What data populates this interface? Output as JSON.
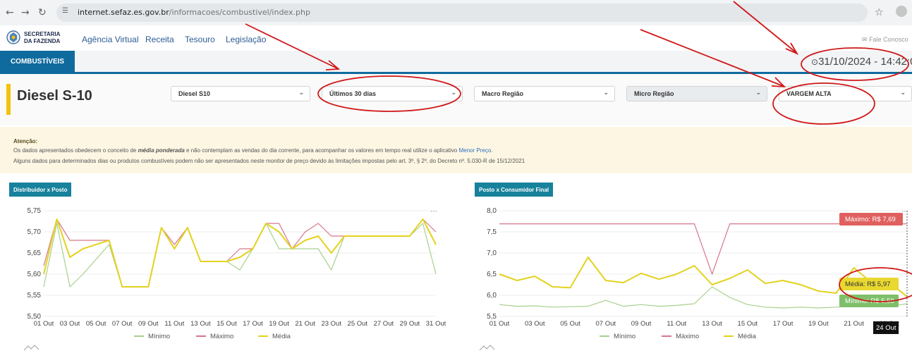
{
  "browser": {
    "back_icon": "back-arrow-icon",
    "url_host": "internet.sefaz.es.gov.br",
    "url_path": "/informacoes/combustivel/index.php"
  },
  "header": {
    "logo_line1": "SECRETARIA",
    "logo_line2": "DA FAZENDA",
    "menu": [
      "Agência Virtual",
      "Receita",
      "Tesouro",
      "Legislação"
    ],
    "contact": "Fale Conosco"
  },
  "tabs": {
    "active": "COMBUSTÍVEIS"
  },
  "clock": "31/10/2024 - 14:42:0",
  "filters": {
    "product_title": "Diesel S-10",
    "product": "Diesel S10",
    "period": "Últimos 30 dias",
    "macro_region": "Macro Região",
    "micro_region": "Micro Região",
    "city": "VARGEM ALTA"
  },
  "alert": {
    "title": "Atenção:",
    "line1_before": "Os dados apresentados obedecem o conceito de ",
    "line1_em": "média ponderada",
    "line1_after": " e não contemplam as vendas do dia corrente, para acompanhar os valores em tempo real utilize o aplicativo ",
    "line1_link": "Menor Preço",
    "line1_end": ".",
    "line2": "Alguns dados para determinados dias ou produtos combustíveis podem não ser apresentados neste monitor de preço devido às limitações impostas pelo art. 3º, § 2º, do Decreto nº. 5.030-R de 15/12/2021"
  },
  "colors": {
    "minimo": "#a8d08d",
    "maximo": "#d6768a",
    "media": "#e3d21f",
    "accent": "#0f6b9e"
  },
  "chart_data": [
    {
      "type": "line",
      "title": "Distribuidor x Posto",
      "tick_labels": [
        "01 Out",
        "03 Out",
        "05 Out",
        "07 Out",
        "09 Out",
        "11 Out",
        "13 Out",
        "15 Out",
        "17 Out",
        "19 Out",
        "21 Out",
        "23 Out",
        "25 Out",
        "27 Out",
        "29 Out",
        "31 Out"
      ],
      "y_ticks": [
        "5,75",
        "5,70",
        "5,65",
        "5,60",
        "5,55",
        "5,50"
      ],
      "ylim": [
        5.5,
        5.75
      ],
      "xlim": [
        1,
        31
      ],
      "legend": [
        "Mínimo",
        "Máximo",
        "Média"
      ],
      "series": [
        {
          "name": "Mínimo",
          "x": [
            1,
            2,
            3,
            4,
            6,
            7,
            8,
            9,
            10,
            11,
            12,
            13,
            14,
            15,
            16,
            17,
            18,
            19,
            20,
            21,
            22,
            23,
            24,
            25,
            26,
            27,
            28,
            29,
            30,
            31
          ],
          "y": [
            5.57,
            5.72,
            5.57,
            5.6,
            5.67,
            5.57,
            5.57,
            5.57,
            5.71,
            5.66,
            5.71,
            5.63,
            5.63,
            5.63,
            5.61,
            5.66,
            5.72,
            5.66,
            5.66,
            5.66,
            5.66,
            5.61,
            5.69,
            5.69,
            5.69,
            5.69,
            5.69,
            5.69,
            5.72,
            5.6
          ]
        },
        {
          "name": "Máximo",
          "x": [
            1,
            2,
            3,
            4,
            6,
            7,
            8,
            9,
            10,
            11,
            12,
            13,
            14,
            15,
            16,
            17,
            18,
            19,
            20,
            21,
            22,
            23,
            24,
            25,
            26,
            27,
            28,
            29,
            30,
            31
          ],
          "y": [
            5.62,
            5.73,
            5.68,
            5.68,
            5.68,
            5.57,
            5.57,
            5.57,
            5.71,
            5.67,
            5.71,
            5.63,
            5.63,
            5.63,
            5.66,
            5.66,
            5.72,
            5.72,
            5.66,
            5.7,
            5.72,
            5.69,
            5.69,
            5.69,
            5.69,
            5.69,
            5.69,
            5.69,
            5.73,
            5.7
          ]
        },
        {
          "name": "Média",
          "x": [
            1,
            2,
            3,
            4,
            6,
            7,
            8,
            9,
            10,
            11,
            12,
            13,
            14,
            15,
            16,
            17,
            18,
            19,
            20,
            21,
            22,
            23,
            24,
            25,
            26,
            27,
            28,
            29,
            30,
            31
          ],
          "y": [
            5.6,
            5.73,
            5.64,
            5.66,
            5.68,
            5.57,
            5.57,
            5.57,
            5.71,
            5.66,
            5.71,
            5.63,
            5.63,
            5.63,
            5.64,
            5.66,
            5.72,
            5.7,
            5.66,
            5.68,
            5.69,
            5.65,
            5.69,
            5.69,
            5.69,
            5.69,
            5.69,
            5.69,
            5.73,
            5.67
          ]
        }
      ]
    },
    {
      "type": "line",
      "title": "Posto x Consumidor Final",
      "tick_labels": [
        "01 Out",
        "03 Out",
        "05 Out",
        "07 Out",
        "09 Out",
        "11 Out",
        "13 Out",
        "15 Out",
        "17 Out",
        "19 Out",
        "21 Out",
        "23 Out"
      ],
      "y_ticks": [
        "8,0",
        "7,5",
        "7,0",
        "6,5",
        "6,0",
        "5,5"
      ],
      "ylim": [
        5.5,
        8.0
      ],
      "xlim": [
        1,
        24
      ],
      "legend": [
        "Mínimo",
        "Máximo",
        "Média"
      ],
      "tooltip": {
        "date": "24 Out",
        "max": "Máximo: R$ 7,69",
        "avg": "Média: R$ 5,97",
        "min": "Mínimo: R$ 5,59"
      },
      "series": [
        {
          "name": "Mínimo",
          "x": [
            1,
            2,
            3,
            4,
            5,
            6,
            7,
            8,
            9,
            10,
            11,
            12,
            13,
            14,
            15,
            16,
            17,
            18,
            19,
            20,
            21,
            22,
            23,
            24
          ],
          "y": [
            5.78,
            5.74,
            5.75,
            5.72,
            5.73,
            5.74,
            5.88,
            5.74,
            5.78,
            5.74,
            5.76,
            5.8,
            6.2,
            5.95,
            5.78,
            5.72,
            5.7,
            5.72,
            5.7,
            5.72,
            5.74,
            5.76,
            5.74,
            5.8
          ]
        },
        {
          "name": "Máximo",
          "x": [
            1,
            2,
            3,
            4,
            5,
            6,
            7,
            8,
            9,
            10,
            11,
            12,
            13,
            14,
            15,
            16,
            17,
            18,
            19,
            20,
            21,
            22,
            23,
            24
          ],
          "y": [
            7.69,
            7.69,
            7.69,
            7.69,
            7.69,
            7.69,
            7.69,
            7.69,
            7.69,
            7.69,
            7.69,
            7.69,
            6.5,
            7.69,
            7.69,
            7.69,
            7.69,
            7.69,
            7.69,
            7.69,
            7.69,
            7.69,
            7.69,
            7.69
          ]
        },
        {
          "name": "Média",
          "x": [
            1,
            2,
            3,
            4,
            5,
            6,
            7,
            8,
            9,
            10,
            11,
            12,
            13,
            14,
            15,
            16,
            17,
            18,
            19,
            20,
            21,
            22,
            23,
            24
          ],
          "y": [
            6.5,
            6.35,
            6.45,
            6.2,
            6.18,
            6.9,
            6.35,
            6.3,
            6.52,
            6.38,
            6.5,
            6.7,
            6.25,
            6.4,
            6.6,
            6.28,
            6.35,
            6.25,
            6.1,
            6.05,
            6.65,
            6.3,
            6.3,
            5.97
          ]
        }
      ]
    }
  ]
}
